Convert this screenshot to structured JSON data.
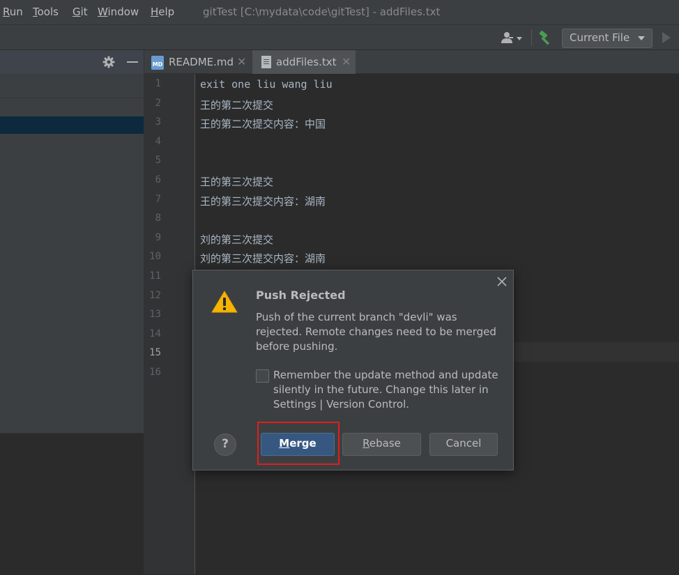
{
  "menubar": {
    "items": [
      {
        "label": "Run",
        "mnemonic": "R",
        "rest": "un"
      },
      {
        "label": "Tools",
        "mnemonic": "T",
        "rest": "ools"
      },
      {
        "label": "Git",
        "mnemonic": "G",
        "rest": "it"
      },
      {
        "label": "Window",
        "mnemonic": "W",
        "rest": "indow"
      },
      {
        "label": "Help",
        "mnemonic": "H",
        "rest": "elp"
      }
    ],
    "window_title": "gitTest [C:\\mydata\\code\\gitTest] - addFiles.txt"
  },
  "toolbar": {
    "run_config": "Current File",
    "icons": [
      "user-icon",
      "hammer-icon",
      "run-icon"
    ],
    "build_color": "#499c54"
  },
  "left_panel": {
    "icons": [
      "gear-icon",
      "minimize-icon"
    ],
    "selection_color": "#0d293e"
  },
  "tabs": [
    {
      "label": "README.md",
      "icon": "markdown-file-icon",
      "active": false
    },
    {
      "label": "addFiles.txt",
      "icon": "text-file-icon",
      "active": true
    }
  ],
  "editor": {
    "line_numbers": [
      "1",
      "2",
      "3",
      "4",
      "5",
      "6",
      "7",
      "8",
      "9",
      "10",
      "11",
      "12",
      "13",
      "14",
      "15",
      "16"
    ],
    "current_line": "15",
    "lines": [
      "exit one liu wang liu",
      "王的第二次提交",
      "王的第二次提交内容：中国",
      "",
      "",
      "王的第三次提交",
      "王的第三次提交内容：湖南",
      "",
      "刘的第三次提交",
      "刘的第三次提交内容：湖南"
    ]
  },
  "dialog": {
    "title": "Push Rejected",
    "message": "Push of the current branch \"devli\" was rejected. Remote changes need to be merged before pushing.",
    "checkbox_label": "Remember the update method and update silently in the future. Change this later in Settings | Version Control.",
    "checkbox_checked": false,
    "help_label": "?",
    "buttons": {
      "merge": {
        "mnemonic": "M",
        "rest": "erge"
      },
      "rebase": {
        "mnemonic": "R",
        "rest": "ebase"
      },
      "cancel": "Cancel"
    },
    "accent_color": "#365880",
    "warning_color": "#f4b400",
    "highlight_color": "#e01e1e"
  }
}
